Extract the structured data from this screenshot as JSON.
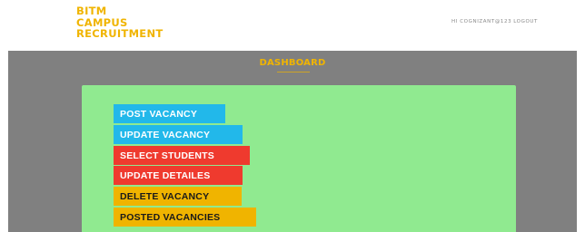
{
  "brand": {
    "line1": "BITM",
    "line2": "CAMPUS",
    "line3": "RECRUITMENT"
  },
  "user_bar": {
    "greeting": "HI COGNIZANT@123",
    "logout_label": "LOGOUT"
  },
  "dashboard": {
    "title": "DASHBOARD"
  },
  "actions": {
    "post_vacancy": "POST VACANCY",
    "update_vacancy": "UPDATE VACANCY",
    "select_students": "SELECT STUDENTS",
    "update_detailes": "UPDATE DETAILES",
    "delete_vacancy": "DELETE VACANCY",
    "posted_vacancies": "POSTED VACANCIES"
  },
  "colors": {
    "brand_yellow": "#f0b400",
    "main_gray": "#808080",
    "panel_green": "#90ea90",
    "button_blue": "#22b8ea",
    "button_red": "#ef3a2e",
    "button_yellow": "#f0b400"
  }
}
